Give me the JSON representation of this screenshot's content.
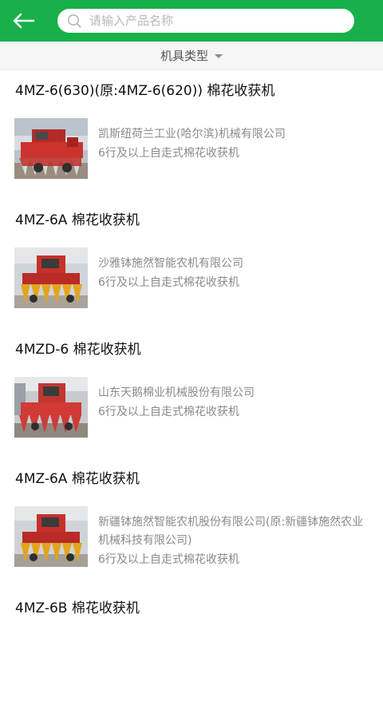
{
  "header": {
    "back_icon": "back-arrow-icon",
    "search_icon": "search-icon",
    "search_placeholder": "请输入产品名称",
    "bar_color": "#17b04a"
  },
  "filter": {
    "label": "机具类型",
    "icon": "caret-down-icon"
  },
  "products": [
    {
      "title": "4MZ-6(630)(原:4MZ-6(620)) 棉花收获机",
      "company": "凯斯纽荷兰工业(哈尔滨)机械有限公司",
      "category": "6行及以上自走式棉花收获机",
      "thumb_color": "#c8312b"
    },
    {
      "title": "4MZ-6A 棉花收获机",
      "company": "沙雅钵施然智能农机有限公司",
      "category": "6行及以上自走式棉花收获机",
      "thumb_color": "#e0a21c"
    },
    {
      "title": "4MZD-6 棉花收获机",
      "company": "山东天鹅棉业机械股份有限公司",
      "category": "6行及以上自走式棉花收获机",
      "thumb_color": "#d13a35"
    },
    {
      "title": "4MZ-6A 棉花收获机",
      "company": "新疆钵施然智能农机股份有限公司(原:新疆钵施然农业机械科技有限公司)",
      "category": "6行及以上自走式棉花收获机",
      "thumb_color": "#e0a21c"
    },
    {
      "title": "4MZ-6B 棉花收获机",
      "company": "",
      "category": "",
      "thumb_color": "#e0a21c"
    }
  ]
}
